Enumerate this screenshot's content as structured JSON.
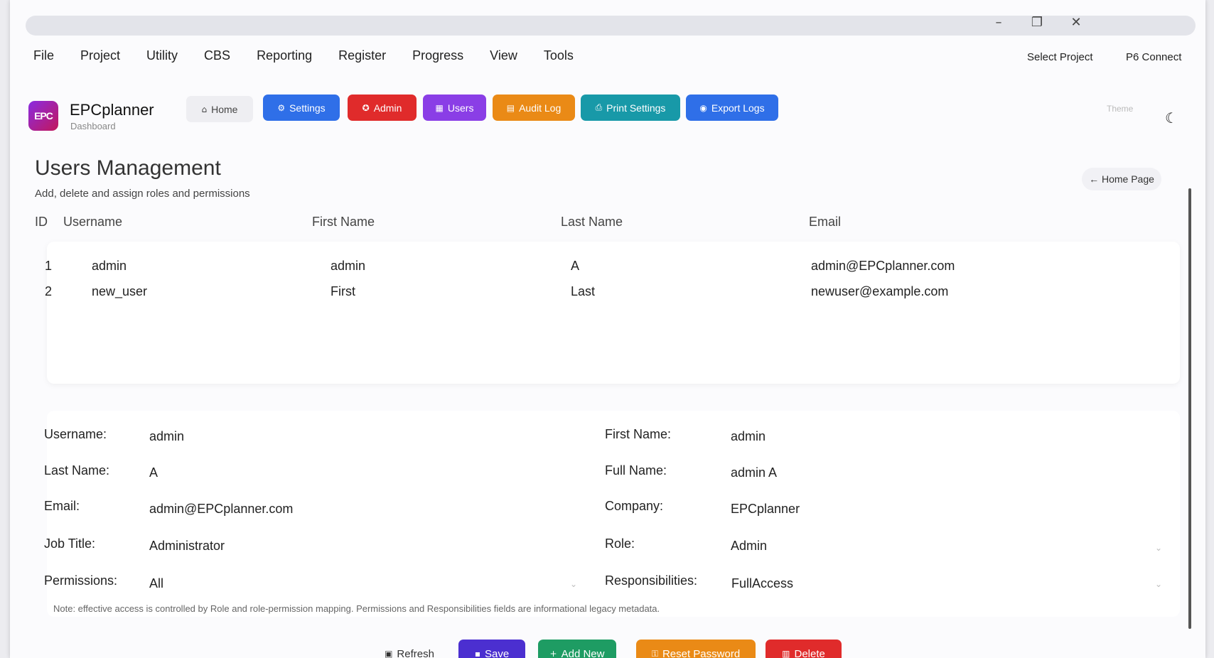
{
  "window": {
    "controls": {
      "minimize": "–",
      "restore": "❐",
      "close": "✕"
    }
  },
  "menu": {
    "items": [
      "File",
      "Project",
      "Utility",
      "CBS",
      "Reporting",
      "Register",
      "Progress",
      "View",
      "Tools"
    ],
    "right": {
      "select_project": "Select Project",
      "p6_connect": "P6 Connect"
    }
  },
  "brand": {
    "logo_text": "EPC",
    "name": "EPCplanner",
    "subtitle": "Dashboard"
  },
  "nav": {
    "home": {
      "label": "Home",
      "icon": "home-icon"
    },
    "buttons": [
      {
        "label": "Settings",
        "icon": "gear-icon",
        "color": "#2f6fe8"
      },
      {
        "label": "Admin",
        "icon": "admin-icon",
        "color": "#e02b2b"
      },
      {
        "label": "Users",
        "icon": "users-icon",
        "color": "#8a3ee6"
      },
      {
        "label": "Audit Log",
        "icon": "clipboard-icon",
        "color": "#ea8a16"
      },
      {
        "label": "Print Settings",
        "icon": "printer-icon",
        "color": "#1899a8"
      },
      {
        "label": "Export Logs",
        "icon": "box-icon",
        "color": "#2f6fe8"
      }
    ],
    "faint_text": "Theme",
    "theme_icon": "moon-icon"
  },
  "page": {
    "title": "Users Management",
    "subtitle": "Add, delete and assign roles and permissions",
    "home_page_button": "← Home Page"
  },
  "table": {
    "columns": [
      "ID",
      "Username",
      "First Name",
      "Last Name",
      "Email"
    ],
    "rows": [
      {
        "id": "1",
        "username": "admin",
        "first_name": "admin",
        "last_name": "A",
        "email": "admin@EPCplanner.com"
      },
      {
        "id": "2",
        "username": "new_user",
        "first_name": "First",
        "last_name": "Last",
        "email": "newuser@example.com"
      }
    ]
  },
  "form": {
    "username": {
      "label": "Username:",
      "value": "admin"
    },
    "first_name": {
      "label": "First Name:",
      "value": "admin"
    },
    "last_name": {
      "label": "Last Name:",
      "value": "A"
    },
    "full_name": {
      "label": "Full Name:",
      "value": "admin A"
    },
    "email": {
      "label": "Email:",
      "value": "admin@EPCplanner.com"
    },
    "company": {
      "label": "Company:",
      "value": "EPCplanner"
    },
    "job_title": {
      "label": "Job Title:",
      "value": "Administrator"
    },
    "role": {
      "label": "Role:",
      "value": "Admin"
    },
    "permissions": {
      "label": "Permissions:",
      "value": "All"
    },
    "responsibilities": {
      "label": "Responsibilities:",
      "value": "FullAccess"
    },
    "note": "Note: effective access is controlled by Role and role-permission mapping. Permissions and Responsibilities fields are informational legacy metadata."
  },
  "actions": {
    "refresh": {
      "label": "Refresh",
      "icon": "refresh-icon"
    },
    "save": {
      "label": "Save",
      "icon": "save-icon",
      "color": "#4b2fd0"
    },
    "add_new": {
      "label": "Add New",
      "icon": "plus-icon",
      "color": "#1e9c63"
    },
    "reset_password": {
      "label": "Reset Password",
      "icon": "key-icon",
      "color": "#ea8a16"
    },
    "delete": {
      "label": "Delete",
      "icon": "trash-icon",
      "color": "#e02b2b"
    }
  }
}
